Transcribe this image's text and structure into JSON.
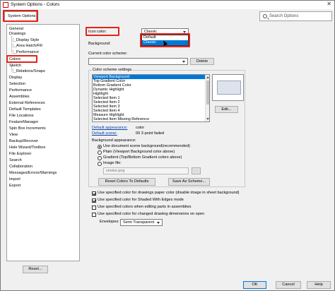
{
  "window": {
    "title": "System Options - Colors",
    "close_glyph": "✕"
  },
  "tabs": {
    "system_options": "System Options"
  },
  "search": {
    "placeholder": "Search Options"
  },
  "tree": {
    "items": [
      "General",
      "Drawings",
      "Display Style",
      "Area Hatch/Fill",
      "Performance",
      "Colors",
      "Sketch",
      "Relations/Snaps",
      "Display",
      "Selection",
      "Performance",
      "Assemblies",
      "External References",
      "Default Templates",
      "File Locations",
      "FeatureManager",
      "Spin Box Increments",
      "View",
      "Backup/Recover",
      "Hole Wizard/Toolbox",
      "File Explorer",
      "Search",
      "Collaboration",
      "Messages/Errors/Warnings",
      "Import",
      "Export"
    ],
    "reset_label": "Reset..."
  },
  "icon_color": {
    "label": "Icon color:",
    "selected": "Classic",
    "options": [
      "Default",
      "Classic"
    ]
  },
  "background": {
    "label": "Background:"
  },
  "scheme": {
    "label": "Current color scheme:",
    "value": "",
    "delete_label": "Delete"
  },
  "settings": {
    "label": "Color scheme settings",
    "items": [
      "Viewport Background",
      "Top Gradient Color",
      "Bottom Gradient Color",
      "Dynamic Highlight",
      "Highlight",
      "Selected Item 1",
      "Selected Item 2",
      "Selected Item 3",
      "Selected Item 4",
      "Measure Highlight",
      "Selected Item Missing Reference"
    ],
    "edit_label": "Edit..."
  },
  "defaults": {
    "appearance_label": "Default appearance:",
    "appearance_value": "color",
    "scene_label": "Default scene:",
    "scene_value": "00 3 point faded"
  },
  "bg_appearance": {
    "label": "Background appearance:",
    "options": [
      "Use document scene background(recommended)",
      "Plain (Viewport Background color above)",
      "Gradient (Top/Bottom Gradient colors above)",
      "Image file:"
    ],
    "image_value": "smoke.png",
    "browse_label": "..."
  },
  "buttons": {
    "reset_defaults": "Reset Colors To Defaults",
    "save_scheme": "Save As Scheme..."
  },
  "checkboxes": [
    {
      "label": "Use specified color for drawings paper color (disable image in sheet background)",
      "checked": true
    },
    {
      "label": "Use specified color for Shaded With Edges mode",
      "checked": true
    },
    {
      "label": "Use specified colors when editing parts in assemblies",
      "checked": false
    },
    {
      "label": "Use specified color for changed drawing dimensions on open",
      "checked": false
    }
  ],
  "envelopes": {
    "label": "Envelopes:",
    "value": "Semi Transparent"
  },
  "footer": {
    "ok": "OK",
    "cancel": "Cancel",
    "help": "Help"
  },
  "colors": {
    "accent": "#0078d7",
    "highlight_box": "#e2231a"
  }
}
